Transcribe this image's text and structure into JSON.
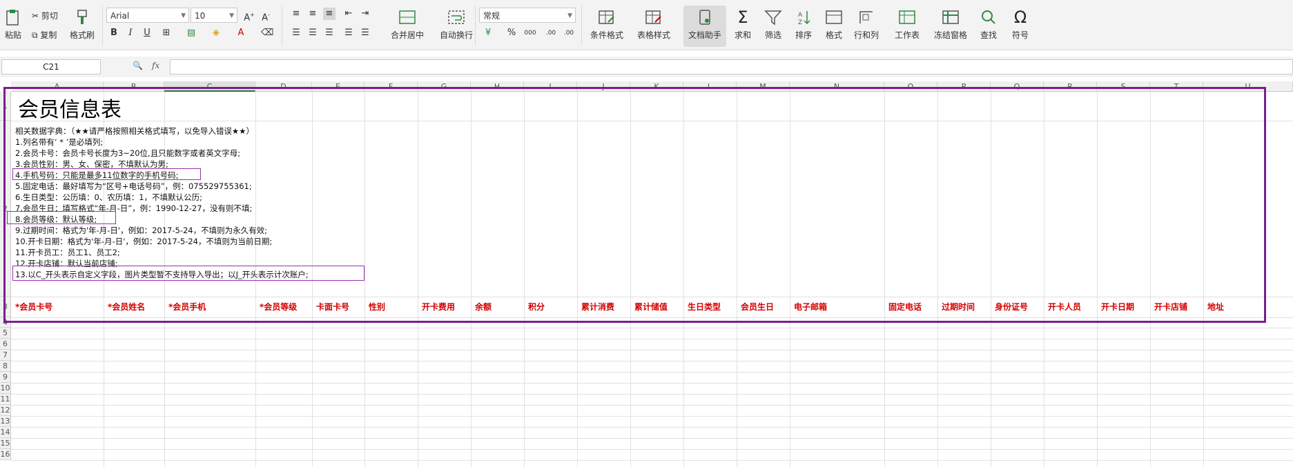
{
  "ribbon": {
    "paste": "粘贴",
    "cut": "剪切",
    "copy": "复制",
    "format_painter": "格式刷",
    "font_name": "Arial",
    "font_size": "10",
    "number_format": "常规",
    "merge_center": "合并居中",
    "wrap_text": "自动换行",
    "conditional_format": "条件格式",
    "table_style": "表格样式",
    "doc_assistant": "文档助手",
    "sum": "求和",
    "filter": "筛选",
    "sort": "排序",
    "format": "格式",
    "row_col": "行和列",
    "worksheet": "工作表",
    "freeze": "冻结窗格",
    "find": "查找",
    "symbol": "符号",
    "bold": "B",
    "italic": "I",
    "underline": "U",
    "font_color_letter": "A",
    "percent": "%",
    "thousands": "000",
    "dec_inc": ".00",
    "dec_dec": ".00"
  },
  "formula_bar": {
    "cell_ref": "C21",
    "fx": "fx",
    "value": ""
  },
  "columns": [
    "A",
    "B",
    "C",
    "D",
    "E",
    "F",
    "G",
    "H",
    "I",
    "J",
    "K",
    "L",
    "M",
    "N",
    "O",
    "P",
    "Q",
    "R",
    "S",
    "T",
    "U"
  ],
  "rows": [
    "1",
    "2",
    "3",
    "4",
    "5",
    "6",
    "7",
    "8",
    "9",
    "10",
    "11",
    "12",
    "13",
    "14",
    "15",
    "16"
  ],
  "sheet": {
    "title": "会员信息表",
    "dictionary": [
      "相关数据字典：（★★请严格按照相关格式填写，以免导入错误★★）",
      "1.列名带有‘ * ’是必填列;",
      "2.会员卡号：会员卡号长度为3~20位,且只能数字或者英文字母;",
      "3.会员性别：男、女、保密，不填默认为男;",
      "4.手机号码：只能是最多11位数字的手机号码;",
      "5.固定电话：最好填写为“区号+电话号码”，例：075529755361;",
      "6.生日类型：公历填：0、农历填：1，不填默认公历;",
      "7.会员生日：填写格式“年-月-日”，例：1990-12-27，没有则不填;",
      "8.会员等级：默认等级;",
      "9.过期时间：格式为'年-月-日'，例如：2017-5-24，不填则为永久有效;",
      "10.开卡日期：格式为'年-月-日'，例如：2017-5-24，不填则为当前日期;",
      "11.开卡员工：员工1、员工2;",
      "12.开卡店铺：默认当前店铺;",
      "13.以C_开头表示自定义字段，图片类型暂不支持导入导出；以J_开头表示计次账户;"
    ],
    "headers": [
      "*会员卡号",
      "*会员姓名",
      "*会员手机",
      "*会员等级",
      "卡面卡号",
      "性别",
      "开卡费用",
      "余额",
      "积分",
      "累计消费",
      "累计储值",
      "生日类型",
      "会员生日",
      "电子邮箱",
      "固定电话",
      "过期时间",
      "身份证号",
      "开卡人员",
      "开卡日期",
      "开卡店铺",
      "地址"
    ]
  }
}
